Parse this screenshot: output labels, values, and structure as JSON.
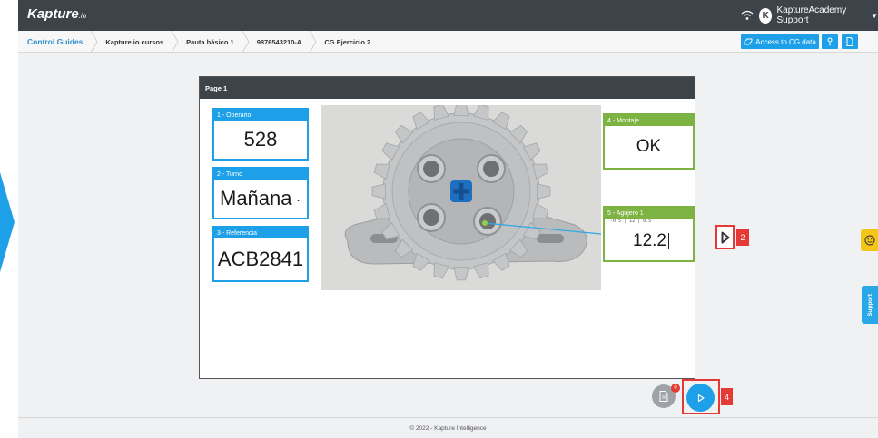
{
  "app": {
    "brand": "Kapture",
    "brand_suffix": ".io",
    "user_initial": "K",
    "user_name": "KaptureAcademy Support"
  },
  "breadcrumb": [
    "Control Guides",
    "Kapture.io cursos",
    "Pauta básico 1",
    "9876543210-A",
    "CG Ejercicio 2"
  ],
  "toolbar": {
    "access_label": "Access to CG data",
    "icons": [
      "key-icon",
      "document-icon"
    ]
  },
  "page": {
    "title": "Page 1",
    "fields": [
      {
        "label": "1 - Operario",
        "value": "528"
      },
      {
        "label": "2 - Turno",
        "value": "Mañana"
      },
      {
        "label": "3 - Referencia",
        "value": "ACB2841"
      },
      {
        "label": "4 - Montaje",
        "value": "OK"
      },
      {
        "label": "5 - Agujero 1",
        "value": "12.2",
        "tolerance": "-0.5 | 12 | 0.5"
      }
    ]
  },
  "annotations": {
    "step_field_next": "2",
    "step_play": "4"
  },
  "actions": {
    "documents_count": "0"
  },
  "footer": {
    "copyright": "© 2022 - Kapture Intelligence"
  },
  "support": {
    "label": "Support"
  },
  "colors": {
    "accent": "#1ea0e8",
    "topbar": "#3d4449",
    "ok_green": "#7cb342",
    "highlight_red": "#e53935",
    "feedback_yellow": "#f5c518"
  }
}
